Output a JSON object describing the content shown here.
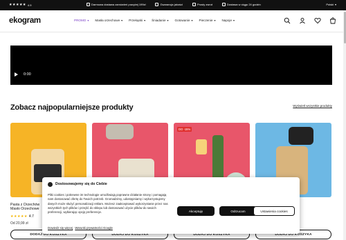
{
  "topbar": {
    "rating": "4.9",
    "stars": "★★★★★",
    "perks": [
      {
        "label": "Darmowa dostawa zamówień powyżej 199zł",
        "icon": "truck-icon"
      },
      {
        "label": "Gwarancja jakości",
        "icon": "shield-icon"
      },
      {
        "label": "Prosty zwrot",
        "icon": "return-icon"
      },
      {
        "label": "Dostawa w ciągu 24 godzin",
        "icon": "clock-icon"
      }
    ],
    "language": "Polski"
  },
  "header": {
    "logo": "ekogram",
    "nav": [
      {
        "label": "PROMO",
        "promo": true
      },
      {
        "label": "Masła orzechowe"
      },
      {
        "label": "Przekąski"
      },
      {
        "label": "Śniadanie"
      },
      {
        "label": "Gotowanie"
      },
      {
        "label": "Pieczenie"
      },
      {
        "label": "Napoje"
      }
    ],
    "icons": [
      "search-icon",
      "user-icon",
      "heart-icon",
      "cart-icon"
    ]
  },
  "video": {
    "time": "0:00"
  },
  "section": {
    "title": "Zobacz najpopularniejsze produkty",
    "link": "Wyświetl wszystkie produkty"
  },
  "products": [
    {
      "name_line1": "Pasta z Orzechów",
      "name_line2": "Masło Orzechowe",
      "rating": "4.7",
      "price": "Od 20,99 zł",
      "badge": "",
      "bg": "#f6b426"
    },
    {
      "name_line1": "",
      "name_line2": "",
      "rating": "",
      "price": "",
      "badge": "",
      "bg": "#e8566a"
    },
    {
      "name_line1": "",
      "name_line2": "",
      "rating": "",
      "price": "",
      "badge": "DO -15%",
      "bg": "#e8566a"
    },
    {
      "name_line1": "",
      "name_line2": "",
      "rating": "",
      "price": "",
      "badge": "",
      "bg": "#6db8e4"
    }
  ],
  "buttons": {
    "add_to_cart": "DODAJ DO KOSZYKA"
  },
  "cookie": {
    "title": "Dostosowujemy się do Ciebie",
    "text": "Pliki cookies i pokrewne im technologie umożliwiają poprawne działanie strony i pomagają nam dostosować ofertę do Twoich potrzeb. Gromadzimy, udostępniamy i wykorzystujemy danych może służyć personalizacji reklam. Możesz zaakceptować wykorzystanie przez nas wszystkich tych plików i przejść do sklepu lub dostosować użycie plików do swoich preferencji, wybierając opcję preferencje.",
    "link1": "Dowiedz się więcej",
    "link2": "Warunki prywatności Google",
    "accept": "Akceptuję",
    "reject": "Odrzucam",
    "settings": "Ustawienia cookies"
  }
}
